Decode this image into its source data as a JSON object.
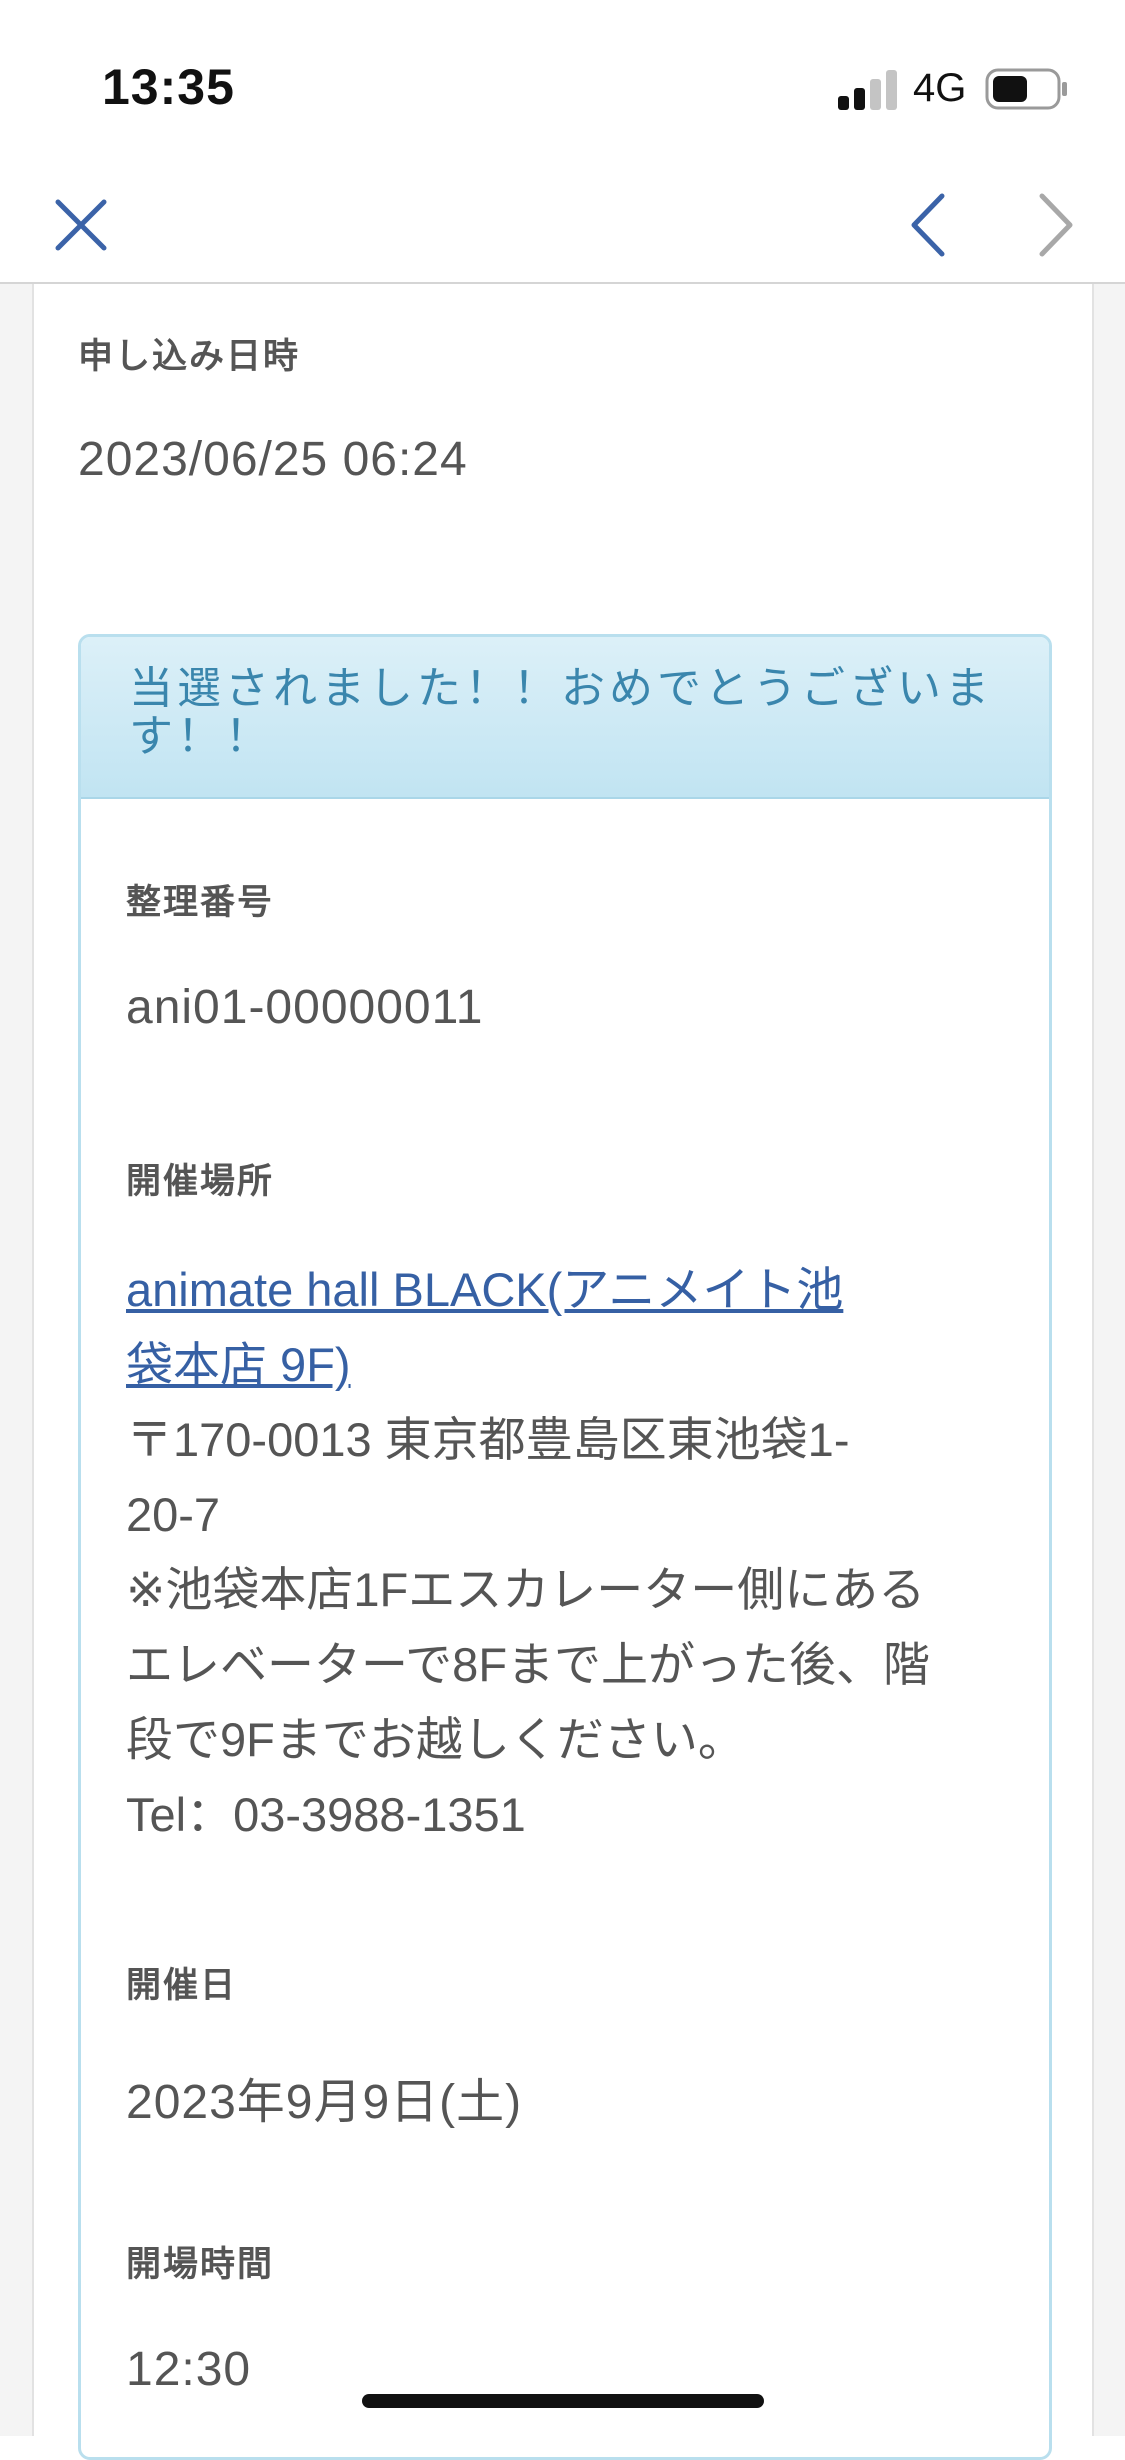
{
  "status_bar": {
    "time": "13:35",
    "network": "4G"
  },
  "nav": {
    "close_icon": "close-icon",
    "back_icon": "chevron-left-icon",
    "forward_icon": "chevron-right-icon"
  },
  "application": {
    "label": "申し込み日時",
    "value": "2023/06/25 06:24"
  },
  "result": {
    "header": "当選されました！！おめでとうございます！！"
  },
  "ticket": {
    "number_label": "整理番号",
    "number_value": "ani01-00000011"
  },
  "venue": {
    "label": "開催場所",
    "link_line1": "animate hall BLACK(アニメイト池",
    "link_line2": "袋本店 9F)",
    "address_line1": "〒170-0013 東京都豊島区東池袋1-",
    "address_line2": "20-7",
    "note_line1": "※池袋本店1Fエスカレーター側にある",
    "note_line2": "エレベーターで8Fまで上がった後、階",
    "note_line3": "段で9Fまでお越しください。",
    "tel": "Tel：03-3988-1351"
  },
  "event_date": {
    "label": "開催日",
    "value": "2023年9月9日(土)"
  },
  "open_time": {
    "label": "開場時間",
    "value": "12:30"
  },
  "colors": {
    "accent": "#3a86ad",
    "link": "#3660a4",
    "nav_icon": "#3b63a8",
    "header_bg": "#cde9f5"
  }
}
